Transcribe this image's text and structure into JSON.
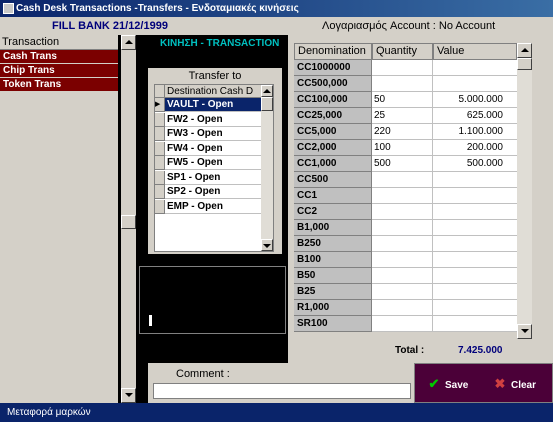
{
  "window": {
    "title": "Cash Desk Transactions  -Transfers - Ενδοταμιακές κινήσεις"
  },
  "header": {
    "fill_info": "FILL BANK  21/12/1999",
    "account": "Λογαριασμός Account :  No Account"
  },
  "transactions": {
    "header": "Transaction",
    "items": [
      "Cash Trans",
      "Chip Trans",
      "Token Trans"
    ]
  },
  "section_title": "ΚΙΝΗΣΗ - TRANSACTION",
  "transfer": {
    "label": "Transfer to",
    "column": "Destination Cash D",
    "destinations": [
      "VAULT - Open",
      "FW2 - Open",
      "FW3 - Open",
      "FW4 - Open",
      "FW5 - Open",
      "SP1 - Open",
      "SP2 - Open",
      "EMP - Open"
    ],
    "selected_index": 0
  },
  "denominations": {
    "headers": {
      "denomination": "Denomination",
      "quantity": "Quantity",
      "value": "Value"
    },
    "rows": [
      {
        "denomination": "CC1000000",
        "quantity": "",
        "value": ""
      },
      {
        "denomination": "CC500,000",
        "quantity": "",
        "value": ""
      },
      {
        "denomination": "CC100,000",
        "quantity": "50",
        "value": "5.000.000"
      },
      {
        "denomination": "CC25,000",
        "quantity": "25",
        "value": "625.000"
      },
      {
        "denomination": "CC5,000",
        "quantity": "220",
        "value": "1.100.000"
      },
      {
        "denomination": "CC2,000",
        "quantity": "100",
        "value": "200.000"
      },
      {
        "denomination": "CC1,000",
        "quantity": "500",
        "value": "500.000"
      },
      {
        "denomination": "CC500",
        "quantity": "",
        "value": ""
      },
      {
        "denomination": "CC1",
        "quantity": "",
        "value": ""
      },
      {
        "denomination": "CC2",
        "quantity": "",
        "value": ""
      },
      {
        "denomination": "B1,000",
        "quantity": "",
        "value": ""
      },
      {
        "denomination": "B250",
        "quantity": "",
        "value": ""
      },
      {
        "denomination": "B100",
        "quantity": "",
        "value": ""
      },
      {
        "denomination": "B50",
        "quantity": "",
        "value": ""
      },
      {
        "denomination": "B25",
        "quantity": "",
        "value": ""
      },
      {
        "denomination": "R1,000",
        "quantity": "",
        "value": ""
      },
      {
        "denomination": "SR100",
        "quantity": "",
        "value": ""
      }
    ]
  },
  "total": {
    "label": "Total :",
    "value": "7.425.000"
  },
  "comment": {
    "label": "Comment :",
    "value": ""
  },
  "buttons": {
    "save": "Save",
    "clear": "Clear"
  },
  "icons": {
    "save": "check-icon",
    "clear": "x-icon"
  },
  "colors": {
    "selected_row": "#0a246a",
    "transaction_item": "#7b0000",
    "button_panel": "#4b0038"
  },
  "statusbar": {
    "text": "Μεταφορά μαρκών"
  }
}
